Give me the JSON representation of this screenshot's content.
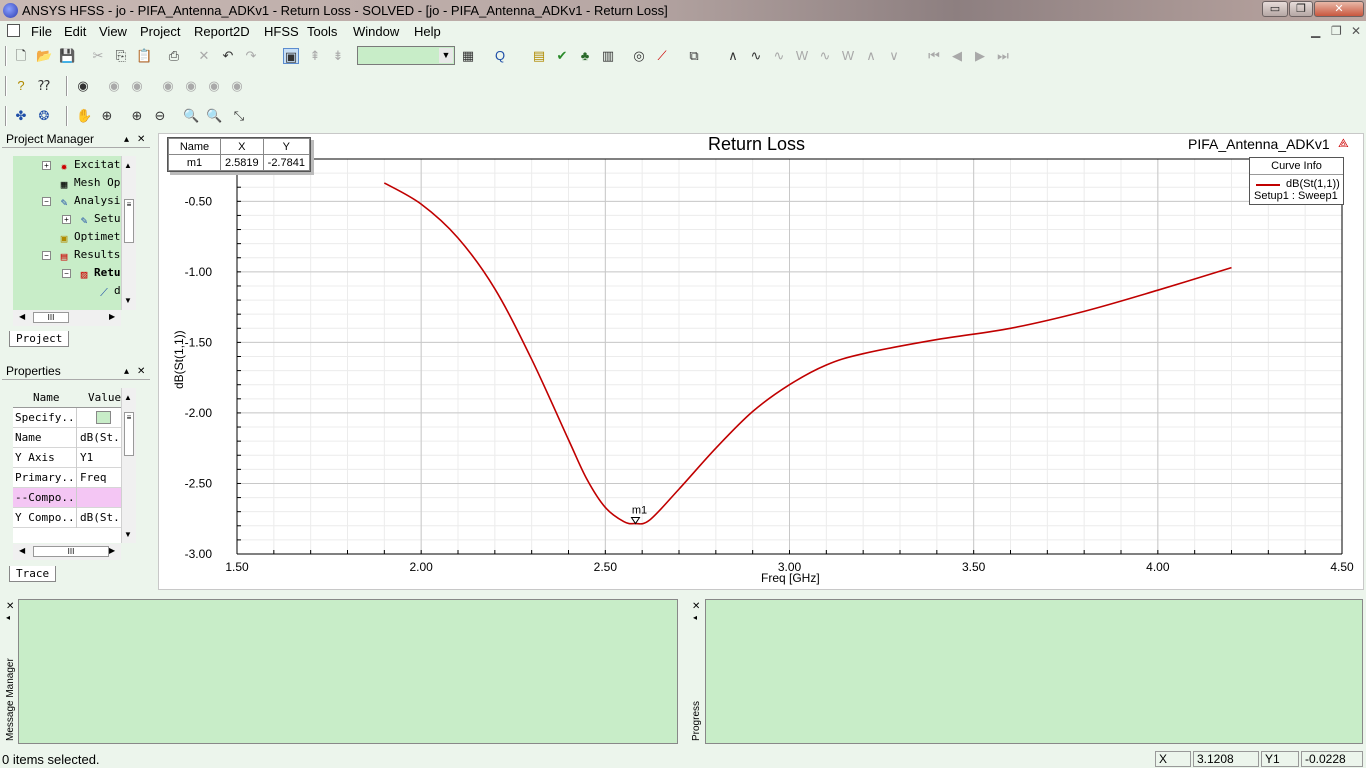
{
  "window": {
    "title": "ANSYS HFSS - jo - PIFA_Antenna_ADKv1 - Return Loss - SOLVED - [jo - PIFA_Antenna_ADKv1 - Return Loss]",
    "minimize": "▭",
    "maximize": "❐",
    "close": "✕"
  },
  "menu": {
    "items": [
      "File",
      "Edit",
      "View",
      "Project",
      "Report2D",
      "HFSS",
      "Tools",
      "Window",
      "Help"
    ]
  },
  "project_manager": {
    "title": "Project Manager",
    "tree": [
      {
        "label": "Excitat",
        "icon": "excitation-icon"
      },
      {
        "label": "Mesh Op",
        "icon": "mesh-icon"
      },
      {
        "label": "Analysi",
        "icon": "analysis-icon"
      },
      {
        "label": "Setu",
        "icon": "setup-icon"
      },
      {
        "label": "Optimet",
        "icon": "optimetrics-icon"
      },
      {
        "label": "Results",
        "icon": "results-icon"
      },
      {
        "label": "Retu",
        "icon": "report-icon"
      },
      {
        "label": "d",
        "icon": "trace-icon"
      }
    ],
    "tab": "Project"
  },
  "properties": {
    "title": "Properties",
    "col_name": "Name",
    "col_value": "Value",
    "rows": [
      {
        "name": "Specify...",
        "value": ""
      },
      {
        "name": "Name",
        "value": "dB(St..."
      },
      {
        "name": "Y Axis",
        "value": "Y1"
      },
      {
        "name": "Primary...",
        "value": "Freq"
      },
      {
        "name": "--Compo...",
        "value": ""
      },
      {
        "name": "Y Compo...",
        "value": "dB(St..."
      }
    ],
    "tab": "Trace"
  },
  "plot": {
    "title": "Return Loss",
    "design": "PIFA_Antenna_ADKv1",
    "marker_table": {
      "headers": [
        "Name",
        "X",
        "Y"
      ],
      "row": [
        "m1",
        "2.5819",
        "-2.7841"
      ]
    },
    "curve_info": {
      "title": "Curve Info",
      "trace": "dB(St(1,1))",
      "setup": "Setup1 : Sweep1"
    },
    "marker_label": "m1"
  },
  "chart_data": {
    "type": "line",
    "xlabel": "Freq [GHz]",
    "ylabel": "dB(St(1,1))",
    "xlim": [
      1.5,
      4.5
    ],
    "ylim": [
      -3.0,
      -0.2
    ],
    "xticks": [
      "1.50",
      "2.00",
      "2.50",
      "3.00",
      "3.50",
      "4.00",
      "4.50"
    ],
    "yticks": [
      "-0.50",
      "-1.00",
      "-1.50",
      "-2.00",
      "-2.50",
      "-3.00"
    ],
    "grid": true,
    "series": [
      {
        "name": "dB(St(1,1))",
        "color": "#c00000",
        "x": [
          1.9,
          2.0,
          2.1,
          2.2,
          2.3,
          2.4,
          2.45,
          2.5,
          2.55,
          2.58,
          2.62,
          2.7,
          2.8,
          2.9,
          3.0,
          3.1,
          3.2,
          3.4,
          3.6,
          3.8,
          4.0,
          4.2
        ],
        "y": [
          -0.37,
          -0.52,
          -0.76,
          -1.12,
          -1.62,
          -2.19,
          -2.47,
          -2.67,
          -2.77,
          -2.784,
          -2.76,
          -2.54,
          -2.25,
          -1.99,
          -1.8,
          -1.66,
          -1.58,
          -1.48,
          -1.4,
          -1.28,
          -1.13,
          -0.97
        ]
      }
    ],
    "marker": {
      "name": "m1",
      "x": 2.5819,
      "y": -2.7841
    }
  },
  "bottom": {
    "message_manager": "Message Manager",
    "progress": "Progress"
  },
  "status": {
    "text": "0 items selected.",
    "x_label": "X",
    "x_value": "3.1208",
    "y_label": "Y1",
    "y_value": "-0.0228"
  },
  "colors": {
    "background": "#ecf5ec",
    "panel_green": "#c8edc8",
    "trace": "#c00000"
  }
}
